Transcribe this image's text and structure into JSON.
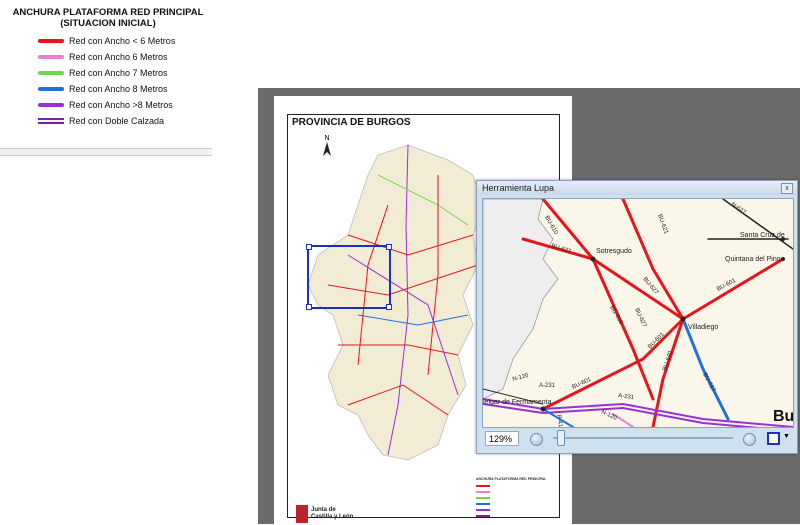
{
  "legend": {
    "title_line1": "ANCHURA PLATAFORMA RED PRINCIPAL",
    "title_line2": "(SITUACION INICIAL)",
    "items": [
      {
        "label": "Red con Ancho < 6 Metros",
        "color": "#e8141b"
      },
      {
        "label": "Red con Ancho 6 Metros",
        "color": "#f07fd3"
      },
      {
        "label": "Red con Ancho 7 Metros",
        "color": "#6ed84a"
      },
      {
        "label": "Red con Ancho 8 Metros",
        "color": "#1f6fe0"
      },
      {
        "label": "Red con Ancho >8 Metros",
        "color": "#9a2fd6"
      },
      {
        "label": "Red con Doble Calzada",
        "color": "#7a1fa3"
      }
    ]
  },
  "map": {
    "title": "PROVINCIA DE BURGOS",
    "north": "N",
    "mini_legend_title": "ANCHURA PLATAFORMA RED PRINCIPAL",
    "logo_line1": "Junta de",
    "logo_line2": "Castilla y León"
  },
  "magnifier": {
    "window_title": "Herramienta Lupa",
    "close": "x",
    "zoom": "129%",
    "places": {
      "santa_cruz": "Santa Cruz de",
      "quintana": "Quintana del Pino",
      "sotresgudo": "Sotresgudo",
      "villadiego": "Villadiego",
      "melgar": "lelgar de Fermamenta",
      "bu_big": "Bu"
    },
    "roads": {
      "bu610": "BU-610",
      "bu621": "BU-621",
      "n627": "N-627",
      "bu627a": "BU-627",
      "bu627b": "BU-627",
      "bu601a": "BU-601",
      "bu601b": "BU-601",
      "bu601c": "BU-601",
      "bu640": "BU-640",
      "bu627c": "BU-627",
      "n120a": "N-120",
      "a231a": "A-231",
      "a231b": "A-231",
      "n120b": "N-120",
      "p410": "P-410",
      "bu627d": "BU-627",
      "bu610b": "BU-610"
    }
  }
}
